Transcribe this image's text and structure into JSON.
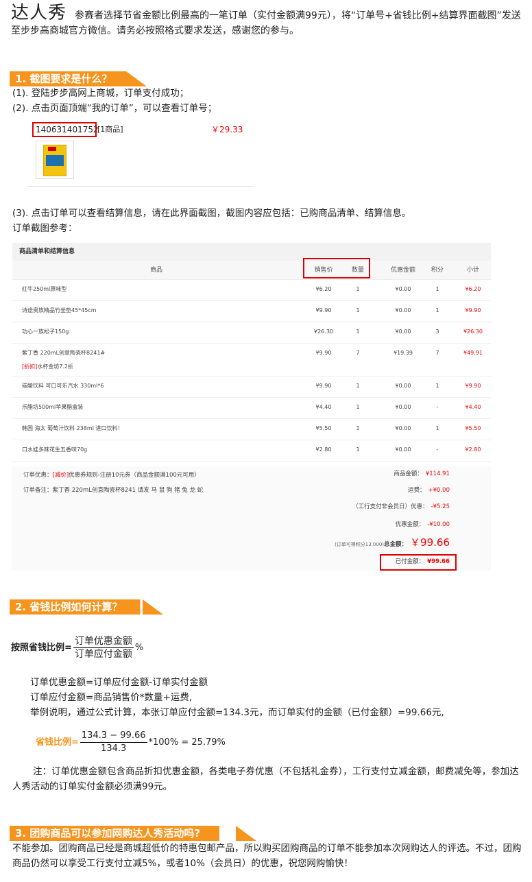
{
  "header": {
    "brand": "达人秀",
    "intro": "参赛者选择节省金额比例最高的一笔订单（实付金额满99元），将“订单号+省钱比例+结算界面截图”发送至步步高商城官方微信。请务必按照格式要求发送，感谢您的参与。"
  },
  "section1": {
    "title": "1. 截图要求是什么？",
    "step1": "(1). 登陆步步高网上商城，订单支付成功；",
    "step2": "(2). 点击页面顶端“我的订单”，可以查看订单号；",
    "order_no": "140631401752",
    "order_items": "[1商品]",
    "order_amount": "￥29.33",
    "step3": "(3). 点击订单可以查看结算信息，请在此界面截图，截图内容应包括：已购商品清单、结算信息。",
    "ref_label": "订单截图参考："
  },
  "table": {
    "title": "商品清单和结算信息",
    "headers": [
      "商品",
      "销售价",
      "数量",
      "优惠金额",
      "积分",
      "小计"
    ],
    "rows": [
      {
        "name": "红牛250ml原味型",
        "price": "¥6.20",
        "qty": "1",
        "disc": "¥0.00",
        "pts": "1",
        "sub": "¥6.20"
      },
      {
        "name": "诗途贵族精品竹坐垫45*45cm",
        "price": "¥9.90",
        "qty": "1",
        "disc": "¥0.00",
        "pts": "1",
        "sub": "¥9.90"
      },
      {
        "name": "功心一族松子150g",
        "price": "¥26.30",
        "qty": "1",
        "disc": "¥0.00",
        "pts": "3",
        "sub": "¥26.30"
      },
      {
        "name": "紫丁香 220mL创意陶瓷杯8241#",
        "price": "¥9.90",
        "qty": "7",
        "disc": "¥19.39",
        "pts": "7",
        "sub": "¥49.91",
        "promo_tag": "[折扣]",
        "promo_text": "水杯金坊7.2折"
      },
      {
        "name": "碳酸饮料 可口可乐汽水 330ml*6",
        "price": "¥9.90",
        "qty": "1",
        "disc": "¥0.00",
        "pts": "1",
        "sub": "¥9.90"
      },
      {
        "name": "乐醋坊500ml苹果醋盒装",
        "price": "¥4.40",
        "qty": "1",
        "disc": "¥0.00",
        "pts": "-",
        "sub": "¥4.40"
      },
      {
        "name": "韩国 海太 葡萄汁饮料 238ml 进口饮料！",
        "price": "¥5.50",
        "qty": "1",
        "disc": "¥0.00",
        "pts": "1",
        "sub": "¥5.50"
      },
      {
        "name": "口水娃多味花生五香味70g",
        "price": "¥2.80",
        "qty": "1",
        "disc": "¥0.00",
        "pts": "-",
        "sub": "¥2.80"
      }
    ],
    "order_promo_label": "订单优惠：",
    "order_promo_tag": "[减价]",
    "order_promo_text": "优惠券规则-注册10元券（商品金额满100元可用）",
    "order_note_label": "订单备注：",
    "order_note_text": "紫丁香 220mL创意陶瓷杯8241 请发 马 鼠 狗 猪 兔 龙 蛇",
    "summary": [
      {
        "label": "商品金额：",
        "value": "¥114.91"
      },
      {
        "label": "运费：",
        "value": "+¥0.00"
      },
      {
        "label": "（工行支付非会员日）优惠：",
        "value": "-¥5.25"
      },
      {
        "label": "优惠金额：",
        "value": "-¥10.00"
      }
    ],
    "total_prefix": "(订单可得积分13.000)",
    "total_label": "总金额：",
    "total_value": "￥99.66",
    "paid_label": "已付金额：",
    "paid_value": "¥99.66"
  },
  "section2": {
    "title": "2. 省钱比例如何计算？",
    "ratio_label": "按照省钱比例=",
    "frac_num": "订单优惠金额",
    "frac_den": "订单应付金额",
    "frac_suffix": "%",
    "line1": "订单优惠金额=订单应付金额-订单实付金额",
    "line2": "订单应付金额=商品销售价*数量+运费,",
    "line3": "举例说明，通过公式计算，本张订单应付金额=134.3元，而订单实付的金额（已付金额）=99.66元,",
    "ex_label": "省钱比例=",
    "ex_num": "134.3 − 99.66",
    "ex_den": "134.3",
    "ex_rest": "*100% = 25.79%",
    "note": "注：订单优惠金额包含商品折扣优惠金额，各类电子券优惠（不包括礼金券），工行支付立减金额，邮费减免等，参加达人秀活动的订单实付金额必须满99元。"
  },
  "section3": {
    "title": "3. 团购商品可以参加网购达人秀活动吗?",
    "body": "不能参加。团购商品已经是商城超低价的特惠包邮产品，所以购买团购商品的订单不能参加本次网购达人的评选。不过，团购商品仍然可以享受工行支付立减5%，或者10%（会员日）的优惠，祝您网购愉快！"
  }
}
